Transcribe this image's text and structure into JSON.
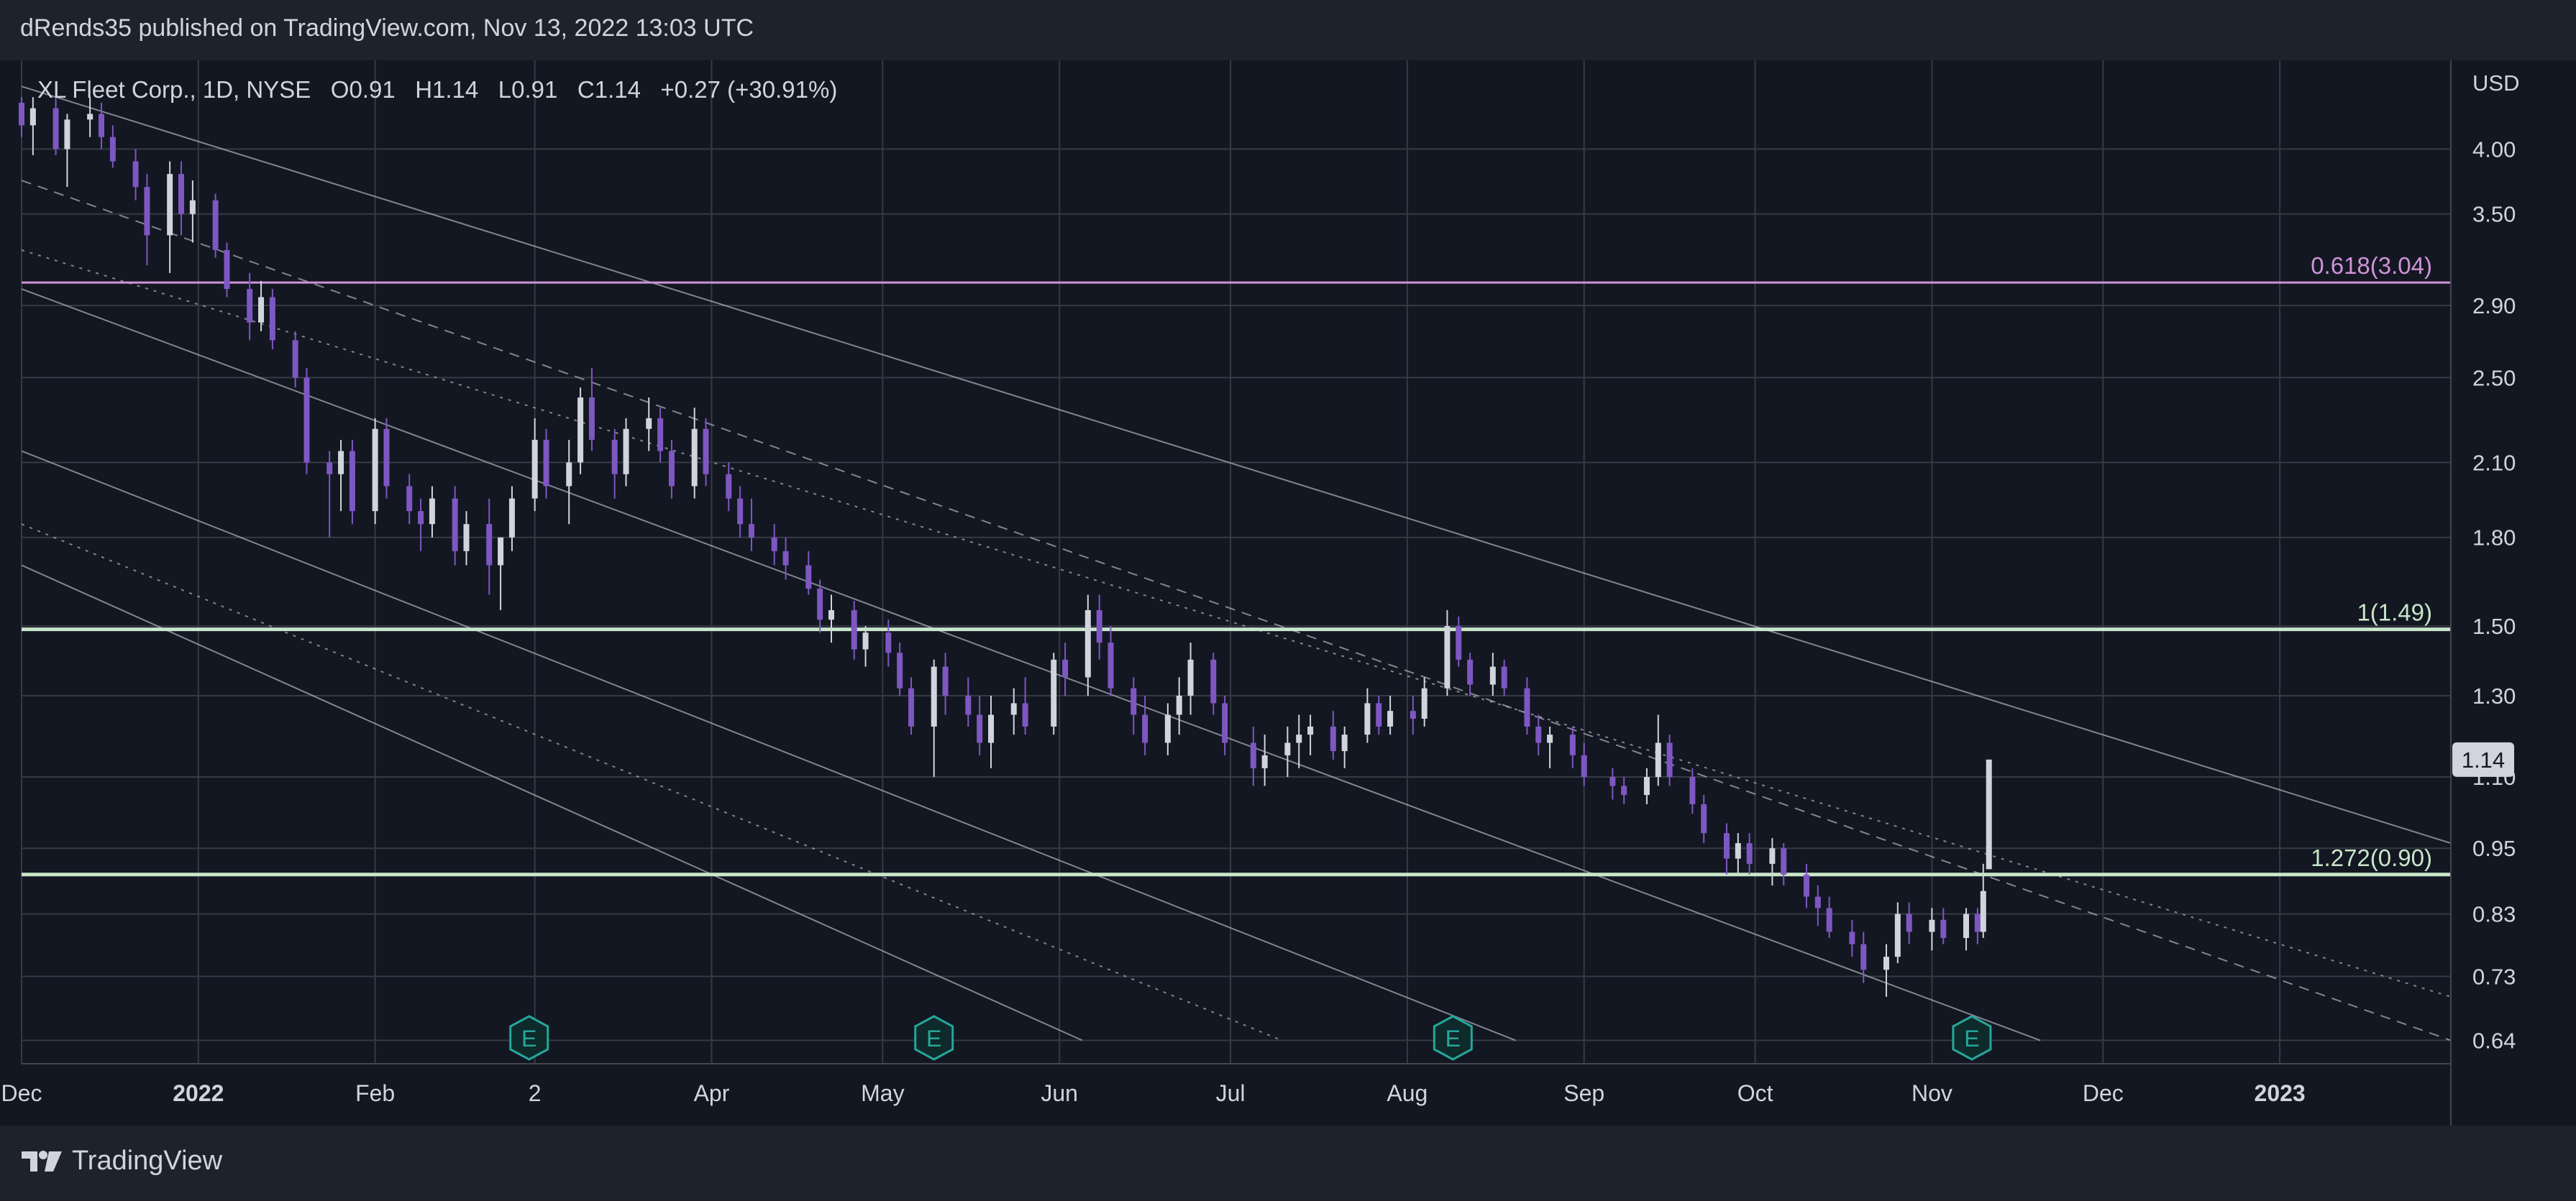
{
  "header": {
    "published_by": "dRends35 published on TradingView.com, Nov 13, 2022 13:03 UTC"
  },
  "legend": {
    "symbol": "XL Fleet Corp., 1D, NYSE",
    "open": "O0.91",
    "high": "H1.14",
    "low": "L0.91",
    "close": "C1.14",
    "change": "+0.27 (+30.91%)"
  },
  "price_axis": {
    "currency": "USD",
    "last_price_label": "1.14"
  },
  "footer": {
    "brand": "TradingView"
  },
  "colors": {
    "background": "#131722",
    "grid": "#363a45",
    "up": "#d1d4dc",
    "down": "#7e57c2",
    "fib_0618": "#ce93d8",
    "fib_line": "#c8e6c9",
    "channel": "#b2b5be",
    "earnings": "#26a69a"
  },
  "chart_data": {
    "type": "candlestick",
    "title": "XL Fleet Corp., 1D, NYSE",
    "x_start": "2021-12-01",
    "x_end": "2023-01-31",
    "y_scale": "log",
    "ylim": [
      0.61,
      4.8
    ],
    "y_ticks": [
      4.0,
      3.5,
      2.9,
      2.5,
      2.1,
      1.8,
      1.5,
      1.3,
      1.1,
      0.95,
      0.83,
      0.73,
      0.64
    ],
    "y_tick_labels": [
      "4.00",
      "3.50",
      "2.90",
      "2.50",
      "2.10",
      "1.80",
      "1.50",
      "1.30",
      "1.10",
      "0.95",
      "0.83",
      "0.73",
      "0.64"
    ],
    "x_ticks": [
      {
        "label": "Dec",
        "date": "2021-12-01"
      },
      {
        "label": "2022",
        "date": "2022-01-01"
      },
      {
        "label": "Feb",
        "date": "2022-02-01"
      },
      {
        "label": "2",
        "date": "2022-03-01"
      },
      {
        "label": "Apr",
        "date": "2022-04-01"
      },
      {
        "label": "May",
        "date": "2022-05-01"
      },
      {
        "label": "Jun",
        "date": "2022-06-01"
      },
      {
        "label": "Jul",
        "date": "2022-07-01"
      },
      {
        "label": "Aug",
        "date": "2022-08-01"
      },
      {
        "label": "Sep",
        "date": "2022-09-01"
      },
      {
        "label": "Oct",
        "date": "2022-10-01"
      },
      {
        "label": "Nov",
        "date": "2022-11-01"
      },
      {
        "label": "Dec",
        "date": "2022-12-01"
      },
      {
        "label": "2023",
        "date": "2023-01-01"
      }
    ],
    "horizontal_levels": [
      {
        "label": "0.618(3.04)",
        "value": 3.04,
        "color": "#ce93d8"
      },
      {
        "label": "1(1.49)",
        "value": 1.49,
        "color": "#c8e6c9"
      },
      {
        "label": "1.272(0.90)",
        "value": 0.9,
        "color": "#c8e6c9"
      }
    ],
    "earnings_markers": [
      {
        "label": "E",
        "date": "2022-02-28"
      },
      {
        "label": "E",
        "date": "2022-05-10"
      },
      {
        "label": "E",
        "date": "2022-08-09"
      },
      {
        "label": "E",
        "date": "2022-11-08"
      }
    ],
    "channel_lines": [
      {
        "style": "solid",
        "points": [
          [
            "2021-12-01",
            4.55
          ],
          [
            "2023-01-31",
            0.96
          ]
        ]
      },
      {
        "style": "dotted",
        "points": [
          [
            "2021-12-01",
            3.25
          ],
          [
            "2023-01-31",
            0.7
          ]
        ]
      },
      {
        "style": "dashed",
        "points": [
          [
            "2021-12-01",
            3.75
          ],
          [
            "2023-01-31",
            0.64
          ]
        ]
      },
      {
        "style": "solid",
        "points": [
          [
            "2021-12-01",
            3.0
          ],
          [
            "2022-11-20",
            0.64
          ]
        ]
      },
      {
        "style": "solid",
        "points": [
          [
            "2021-12-01",
            2.15
          ],
          [
            "2022-08-20",
            0.64
          ]
        ]
      },
      {
        "style": "dotted",
        "points": [
          [
            "2021-12-01",
            1.85
          ],
          [
            "2022-07-10",
            0.64
          ]
        ]
      },
      {
        "style": "solid",
        "points": [
          [
            "2021-12-01",
            1.7
          ],
          [
            "2022-06-05",
            0.64
          ]
        ]
      }
    ],
    "series": [
      {
        "name": "XL",
        "ohlc": [
          [
            "2021-12-01",
            4.4,
            4.45,
            4.1,
            4.2
          ],
          [
            "2021-12-03",
            4.2,
            4.45,
            3.95,
            4.35
          ],
          [
            "2021-12-07",
            4.35,
            4.45,
            3.95,
            4.0
          ],
          [
            "2021-12-09",
            4.0,
            4.3,
            3.7,
            4.25
          ],
          [
            "2021-12-13",
            4.25,
            4.45,
            4.1,
            4.3
          ],
          [
            "2021-12-15",
            4.3,
            4.4,
            4.0,
            4.1
          ],
          [
            "2021-12-17",
            4.1,
            4.2,
            3.85,
            3.9
          ],
          [
            "2021-12-21",
            3.9,
            4.0,
            3.6,
            3.7
          ],
          [
            "2021-12-23",
            3.7,
            3.8,
            3.15,
            3.35
          ],
          [
            "2021-12-27",
            3.35,
            3.9,
            3.1,
            3.8
          ],
          [
            "2021-12-29",
            3.8,
            3.9,
            3.35,
            3.5
          ],
          [
            "2021-12-31",
            3.5,
            3.75,
            3.3,
            3.6
          ],
          [
            "2022-01-04",
            3.6,
            3.65,
            3.2,
            3.25
          ],
          [
            "2022-01-06",
            3.25,
            3.3,
            2.95,
            3.0
          ],
          [
            "2022-01-10",
            3.0,
            3.1,
            2.7,
            2.8
          ],
          [
            "2022-01-12",
            2.8,
            3.05,
            2.75,
            2.95
          ],
          [
            "2022-01-14",
            2.95,
            3.0,
            2.65,
            2.7
          ],
          [
            "2022-01-18",
            2.7,
            2.75,
            2.45,
            2.5
          ],
          [
            "2022-01-20",
            2.5,
            2.55,
            2.05,
            2.1
          ],
          [
            "2022-01-24",
            2.1,
            2.15,
            1.8,
            2.05
          ],
          [
            "2022-01-26",
            2.05,
            2.2,
            1.9,
            2.15
          ],
          [
            "2022-01-28",
            2.15,
            2.2,
            1.85,
            1.9
          ],
          [
            "2022-02-01",
            1.9,
            2.3,
            1.85,
            2.25
          ],
          [
            "2022-02-03",
            2.25,
            2.3,
            1.95,
            2.0
          ],
          [
            "2022-02-07",
            2.0,
            2.05,
            1.85,
            1.9
          ],
          [
            "2022-02-09",
            1.9,
            1.95,
            1.75,
            1.85
          ],
          [
            "2022-02-11",
            1.85,
            2.0,
            1.8,
            1.95
          ],
          [
            "2022-02-15",
            1.95,
            2.0,
            1.7,
            1.75
          ],
          [
            "2022-02-17",
            1.75,
            1.9,
            1.7,
            1.85
          ],
          [
            "2022-02-21",
            1.85,
            1.95,
            1.6,
            1.7
          ],
          [
            "2022-02-23",
            1.7,
            1.8,
            1.55,
            1.8
          ],
          [
            "2022-02-25",
            1.8,
            2.0,
            1.75,
            1.95
          ],
          [
            "2022-03-01",
            1.95,
            2.3,
            1.9,
            2.2
          ],
          [
            "2022-03-03",
            2.2,
            2.25,
            1.95,
            2.0
          ],
          [
            "2022-03-07",
            2.0,
            2.2,
            1.85,
            2.1
          ],
          [
            "2022-03-09",
            2.1,
            2.45,
            2.05,
            2.4
          ],
          [
            "2022-03-11",
            2.4,
            2.55,
            2.15,
            2.2
          ],
          [
            "2022-03-15",
            2.2,
            2.25,
            1.95,
            2.05
          ],
          [
            "2022-03-17",
            2.05,
            2.3,
            2.0,
            2.25
          ],
          [
            "2022-03-21",
            2.25,
            2.4,
            2.15,
            2.3
          ],
          [
            "2022-03-23",
            2.3,
            2.35,
            2.1,
            2.15
          ],
          [
            "2022-03-25",
            2.15,
            2.2,
            1.95,
            2.0
          ],
          [
            "2022-03-29",
            2.0,
            2.35,
            1.95,
            2.25
          ],
          [
            "2022-03-31",
            2.25,
            2.3,
            2.0,
            2.05
          ],
          [
            "2022-04-04",
            2.05,
            2.1,
            1.9,
            1.95
          ],
          [
            "2022-04-06",
            1.95,
            2.0,
            1.8,
            1.85
          ],
          [
            "2022-04-08",
            1.85,
            1.95,
            1.75,
            1.8
          ],
          [
            "2022-04-12",
            1.8,
            1.85,
            1.7,
            1.75
          ],
          [
            "2022-04-14",
            1.75,
            1.8,
            1.65,
            1.7
          ],
          [
            "2022-04-18",
            1.7,
            1.75,
            1.6,
            1.62
          ],
          [
            "2022-04-20",
            1.62,
            1.65,
            1.48,
            1.52
          ],
          [
            "2022-04-22",
            1.52,
            1.6,
            1.45,
            1.55
          ],
          [
            "2022-04-26",
            1.55,
            1.58,
            1.4,
            1.43
          ],
          [
            "2022-04-28",
            1.43,
            1.5,
            1.38,
            1.48
          ],
          [
            "2022-05-02",
            1.48,
            1.52,
            1.38,
            1.42
          ],
          [
            "2022-05-04",
            1.42,
            1.45,
            1.3,
            1.32
          ],
          [
            "2022-05-06",
            1.32,
            1.35,
            1.2,
            1.22
          ],
          [
            "2022-05-10",
            1.22,
            1.4,
            1.1,
            1.38
          ],
          [
            "2022-05-12",
            1.38,
            1.42,
            1.25,
            1.3
          ],
          [
            "2022-05-16",
            1.3,
            1.35,
            1.22,
            1.25
          ],
          [
            "2022-05-18",
            1.25,
            1.3,
            1.15,
            1.18
          ],
          [
            "2022-05-20",
            1.18,
            1.3,
            1.12,
            1.25
          ],
          [
            "2022-05-24",
            1.25,
            1.32,
            1.2,
            1.28
          ],
          [
            "2022-05-26",
            1.28,
            1.35,
            1.2,
            1.22
          ],
          [
            "2022-05-31",
            1.22,
            1.42,
            1.2,
            1.4
          ],
          [
            "2022-06-02",
            1.4,
            1.45,
            1.3,
            1.35
          ],
          [
            "2022-06-06",
            1.35,
            1.6,
            1.3,
            1.55
          ],
          [
            "2022-06-08",
            1.55,
            1.6,
            1.4,
            1.45
          ],
          [
            "2022-06-10",
            1.45,
            1.5,
            1.3,
            1.32
          ],
          [
            "2022-06-14",
            1.32,
            1.35,
            1.2,
            1.25
          ],
          [
            "2022-06-16",
            1.25,
            1.3,
            1.15,
            1.18
          ],
          [
            "2022-06-20",
            1.18,
            1.28,
            1.15,
            1.25
          ],
          [
            "2022-06-22",
            1.25,
            1.35,
            1.2,
            1.3
          ],
          [
            "2022-06-24",
            1.3,
            1.45,
            1.25,
            1.4
          ],
          [
            "2022-06-28",
            1.4,
            1.42,
            1.25,
            1.28
          ],
          [
            "2022-06-30",
            1.28,
            1.3,
            1.15,
            1.18
          ],
          [
            "2022-07-05",
            1.18,
            1.22,
            1.08,
            1.12
          ],
          [
            "2022-07-07",
            1.12,
            1.2,
            1.08,
            1.15
          ],
          [
            "2022-07-11",
            1.15,
            1.22,
            1.1,
            1.18
          ],
          [
            "2022-07-13",
            1.18,
            1.25,
            1.12,
            1.2
          ],
          [
            "2022-07-15",
            1.2,
            1.25,
            1.15,
            1.22
          ],
          [
            "2022-07-19",
            1.22,
            1.26,
            1.14,
            1.16
          ],
          [
            "2022-07-21",
            1.16,
            1.22,
            1.12,
            1.2
          ],
          [
            "2022-07-25",
            1.2,
            1.32,
            1.18,
            1.28
          ],
          [
            "2022-07-27",
            1.28,
            1.3,
            1.2,
            1.22
          ],
          [
            "2022-07-29",
            1.22,
            1.3,
            1.2,
            1.26
          ],
          [
            "2022-08-02",
            1.26,
            1.3,
            1.2,
            1.24
          ],
          [
            "2022-08-04",
            1.24,
            1.35,
            1.22,
            1.32
          ],
          [
            "2022-08-08",
            1.32,
            1.55,
            1.3,
            1.5
          ],
          [
            "2022-08-10",
            1.5,
            1.53,
            1.38,
            1.4
          ],
          [
            "2022-08-12",
            1.4,
            1.42,
            1.3,
            1.33
          ],
          [
            "2022-08-16",
            1.33,
            1.42,
            1.3,
            1.38
          ],
          [
            "2022-08-18",
            1.38,
            1.4,
            1.3,
            1.32
          ],
          [
            "2022-08-22",
            1.32,
            1.35,
            1.2,
            1.22
          ],
          [
            "2022-08-24",
            1.22,
            1.25,
            1.15,
            1.18
          ],
          [
            "2022-08-26",
            1.18,
            1.22,
            1.12,
            1.2
          ],
          [
            "2022-08-30",
            1.2,
            1.22,
            1.12,
            1.15
          ],
          [
            "2022-09-01",
            1.15,
            1.18,
            1.08,
            1.1
          ],
          [
            "2022-09-06",
            1.1,
            1.12,
            1.05,
            1.08
          ],
          [
            "2022-09-08",
            1.08,
            1.1,
            1.04,
            1.06
          ],
          [
            "2022-09-12",
            1.06,
            1.12,
            1.04,
            1.1
          ],
          [
            "2022-09-14",
            1.1,
            1.25,
            1.08,
            1.18
          ],
          [
            "2022-09-16",
            1.18,
            1.2,
            1.08,
            1.1
          ],
          [
            "2022-09-20",
            1.1,
            1.12,
            1.02,
            1.04
          ],
          [
            "2022-09-22",
            1.04,
            1.06,
            0.96,
            0.98
          ],
          [
            "2022-09-26",
            0.98,
            1.0,
            0.9,
            0.93
          ],
          [
            "2022-09-28",
            0.93,
            0.98,
            0.9,
            0.96
          ],
          [
            "2022-09-30",
            0.96,
            0.98,
            0.9,
            0.92
          ],
          [
            "2022-10-04",
            0.92,
            0.97,
            0.88,
            0.95
          ],
          [
            "2022-10-06",
            0.95,
            0.96,
            0.88,
            0.9
          ],
          [
            "2022-10-10",
            0.9,
            0.92,
            0.84,
            0.86
          ],
          [
            "2022-10-12",
            0.86,
            0.88,
            0.81,
            0.84
          ],
          [
            "2022-10-14",
            0.84,
            0.86,
            0.79,
            0.8
          ],
          [
            "2022-10-18",
            0.8,
            0.82,
            0.76,
            0.78
          ],
          [
            "2022-10-20",
            0.78,
            0.8,
            0.72,
            0.74
          ],
          [
            "2022-10-24",
            0.74,
            0.78,
            0.7,
            0.76
          ],
          [
            "2022-10-26",
            0.76,
            0.85,
            0.75,
            0.83
          ],
          [
            "2022-10-28",
            0.83,
            0.85,
            0.78,
            0.8
          ],
          [
            "2022-11-01",
            0.8,
            0.84,
            0.77,
            0.82
          ],
          [
            "2022-11-03",
            0.82,
            0.84,
            0.78,
            0.79
          ],
          [
            "2022-11-07",
            0.79,
            0.84,
            0.77,
            0.83
          ],
          [
            "2022-11-09",
            0.83,
            0.84,
            0.78,
            0.8
          ],
          [
            "2022-11-10",
            0.8,
            0.92,
            0.79,
            0.87
          ],
          [
            "2022-11-11",
            0.91,
            1.14,
            0.91,
            1.14
          ]
        ]
      }
    ]
  }
}
